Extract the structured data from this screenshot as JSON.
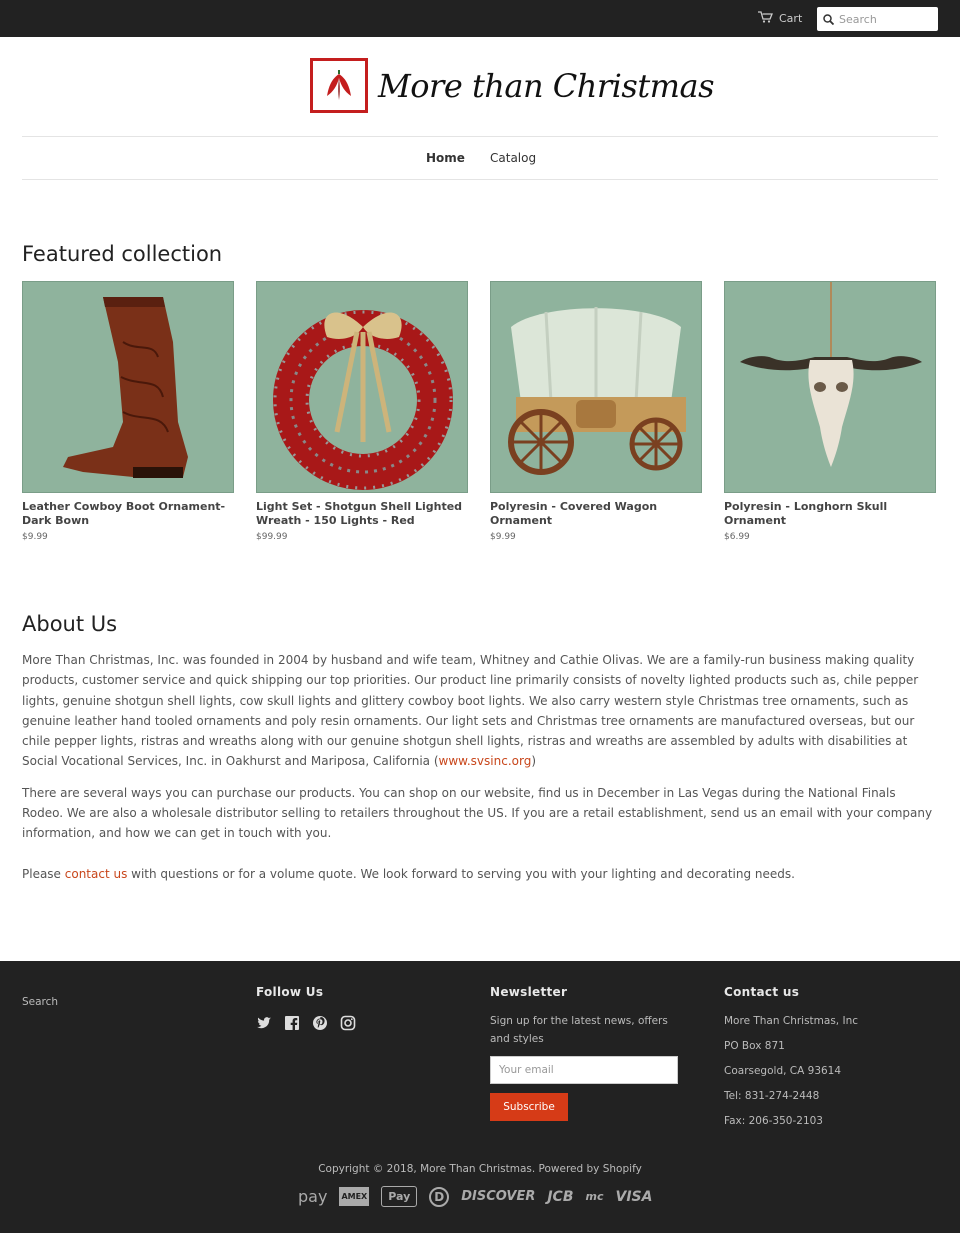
{
  "header": {
    "cart_label": "Cart",
    "search_placeholder": "Search",
    "logo_text": "More than Christmas"
  },
  "nav": {
    "items": [
      {
        "label": "Home"
      },
      {
        "label": "Catalog"
      }
    ]
  },
  "featured": {
    "heading": "Featured collection",
    "products": [
      {
        "title": "Leather Cowboy Boot Ornament-Dark Bown",
        "price": "$9.99"
      },
      {
        "title": "Light Set - Shotgun Shell Lighted Wreath - 150 Lights - Red",
        "price": "$99.99"
      },
      {
        "title": "Polyresin - Covered Wagon Ornament",
        "price": "$9.99"
      },
      {
        "title": "Polyresin - Longhorn Skull Ornament",
        "price": "$6.99"
      }
    ]
  },
  "about": {
    "heading": "About Us",
    "p1": "More Than Christmas, Inc. was founded in 2004 by husband and wife team, Whitney and Cathie Olivas. We are a family-run business making quality products, customer service and quick shipping our top priorities. Our product line primarily consists of novelty lighted products such as, chile pepper lights, genuine shotgun shell lights, cow skull lights and glittery cowboy boot lights. We also carry western style Christmas tree ornaments, such as genuine leather hand tooled ornaments and poly resin ornaments. Our light sets and Christmas tree ornaments are manufactured overseas, but our chile pepper lights, ristras and wreaths along with our genuine shotgun shell lights, ristras and wreaths are assembled by adults with disabilities at Social Vocational Services, Inc. in Oakhurst and Mariposa, California (",
    "p1_link": "www.svsinc.org",
    "p1_end": ")",
    "p2": "There are several ways you can purchase our products. You can shop on our website, find us in December in Las Vegas during the National Finals Rodeo. We are also a wholesale distributor selling to retailers throughout the US. If you are a retail establishment, send us an email with your company information, and how we can get in touch with you.",
    "p3_start": "Please ",
    "p3_link": "contact us",
    "p3_end": " with questions or for a volume quote. We look forward to serving you with your lighting and decorating needs."
  },
  "footer": {
    "search_link": "Search",
    "follow_heading": "Follow Us",
    "newsletter_heading": "Newsletter",
    "newsletter_text": "Sign up for the latest news, offers and styles",
    "email_placeholder": "Your email",
    "subscribe_label": "Subscribe",
    "contact_heading": "Contact us",
    "contact_lines": [
      "More Than Christmas, Inc",
      "PO Box 871",
      "Coarsegold, CA  93614",
      "Tel: 831-274-2448",
      "Fax: 206-350-2103"
    ],
    "copyright": "Copyright © 2018, More Than Christmas. Powered by Shopify",
    "payment_icons": [
      "amazon-pay-icon",
      "american-express-icon",
      "apple-pay-icon",
      "diners-club-icon",
      "discover-icon",
      "jcb-icon",
      "mastercard-icon",
      "visa-icon"
    ],
    "payment_labels": [
      "pay",
      "AMEX",
      "Pay",
      "D",
      "DISCOVER",
      "JCB",
      "mc",
      "VISA"
    ]
  },
  "colors": {
    "topbar": "#222222",
    "accent": "#d63b17",
    "link": "#c8461b",
    "logo_red": "#c41e1e",
    "product_bg": "#8fb39d"
  }
}
